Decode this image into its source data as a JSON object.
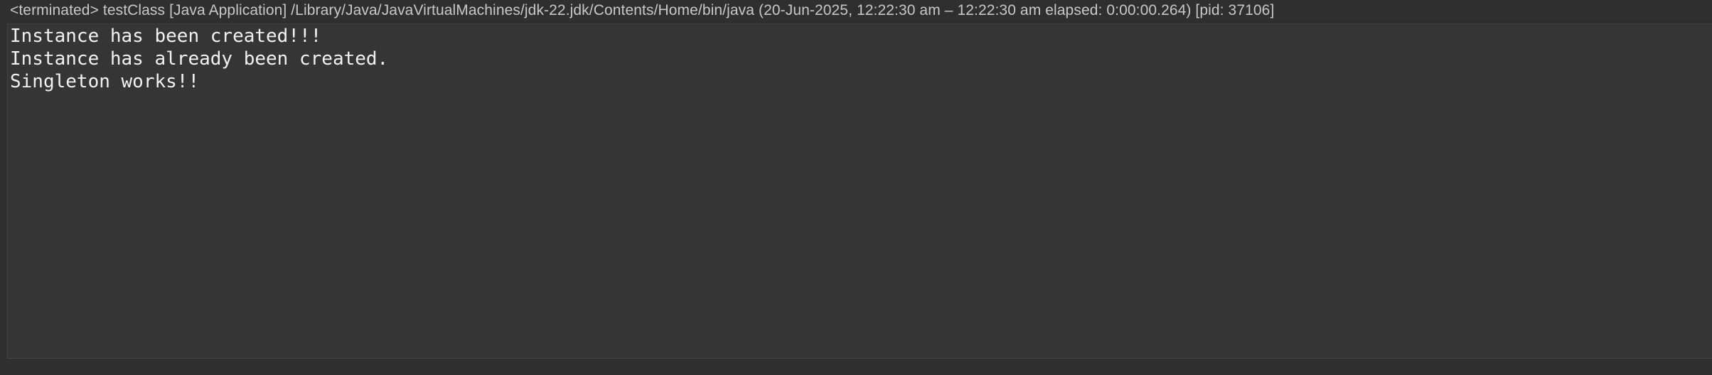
{
  "console": {
    "header": "<terminated> testClass [Java Application] /Library/Java/JavaVirtualMachines/jdk-22.jdk/Contents/Home/bin/java  (20-Jun-2025, 12:22:30 am – 12:22:30 am elapsed: 0:00:00.264) [pid: 37106]",
    "lines": [
      "Instance has been created!!!",
      "Instance has already been created.",
      "Singleton works!!"
    ]
  },
  "colors": {
    "background": "#2e2e2e",
    "console_area": "#353535",
    "header_text": "#c8c8c8",
    "output_text": "#f2f2f2"
  }
}
